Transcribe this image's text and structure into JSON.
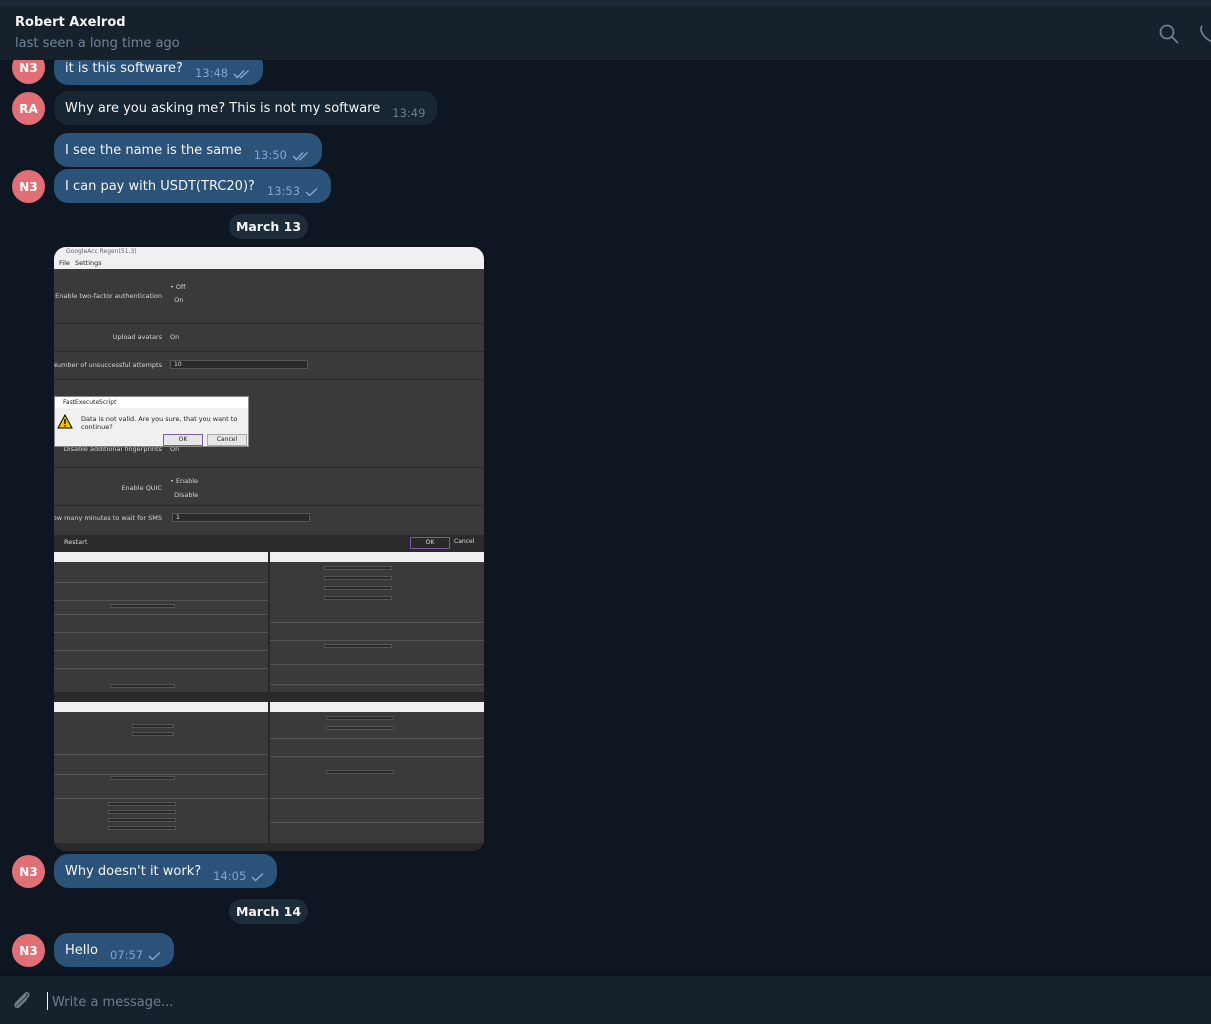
{
  "header": {
    "name": "Robert Axelrod",
    "status": "last seen a long time ago"
  },
  "messages": [
    {
      "avatar": "N3",
      "text": "it is this software?",
      "time": "13:48",
      "ticks": "double"
    },
    {
      "avatar": "RA",
      "text": "Why are you asking me? This is not my software",
      "time": "13:49"
    },
    {
      "text": "I see the name is the same",
      "time": "13:50",
      "ticks": "double"
    },
    {
      "avatar": "N3",
      "text": "I can pay with USDT(TRC20)?",
      "time": "13:53",
      "ticks": "single"
    },
    {
      "avatar": "N3",
      "text": "Why doesn't it work?",
      "time": "14:05",
      "ticks": "single"
    },
    {
      "avatar": "N3",
      "text": "Hello",
      "time": "07:57",
      "ticks": "single"
    }
  ],
  "dates": [
    "March 13",
    "March 14"
  ],
  "photo": {
    "window_title": "GoogleAcc Regen(51.3)",
    "menu": [
      "File",
      "Settings"
    ],
    "rows": [
      {
        "label": "Enable two-factor authentication",
        "options": [
          "Off",
          "On"
        ]
      },
      {
        "label": "Upload avatars",
        "value": "On"
      },
      {
        "label": "Number of unsuccessful attempts",
        "value": "10"
      },
      {
        "label": "Disable additional fingerprints",
        "value": "On"
      },
      {
        "label": "Enable QUIC",
        "options": [
          "Enable",
          "Disable"
        ]
      },
      {
        "label": "How many minutes to wait for SMS",
        "value": "1"
      }
    ],
    "dialog": {
      "title": "FastExecuteScript",
      "message": "Data is not valid. Are you sure, that you want to continue?",
      "ok": "OK",
      "cancel": "Cancel"
    },
    "footer": {
      "restart": "Restart",
      "ok": "OK",
      "cancel": "Cancel"
    }
  },
  "input": {
    "placeholder": "Write a message..."
  },
  "colors": {
    "background": "#0e1621",
    "outgoing": "#2b5278",
    "incoming": "#182533",
    "avatar": "#e17076"
  }
}
